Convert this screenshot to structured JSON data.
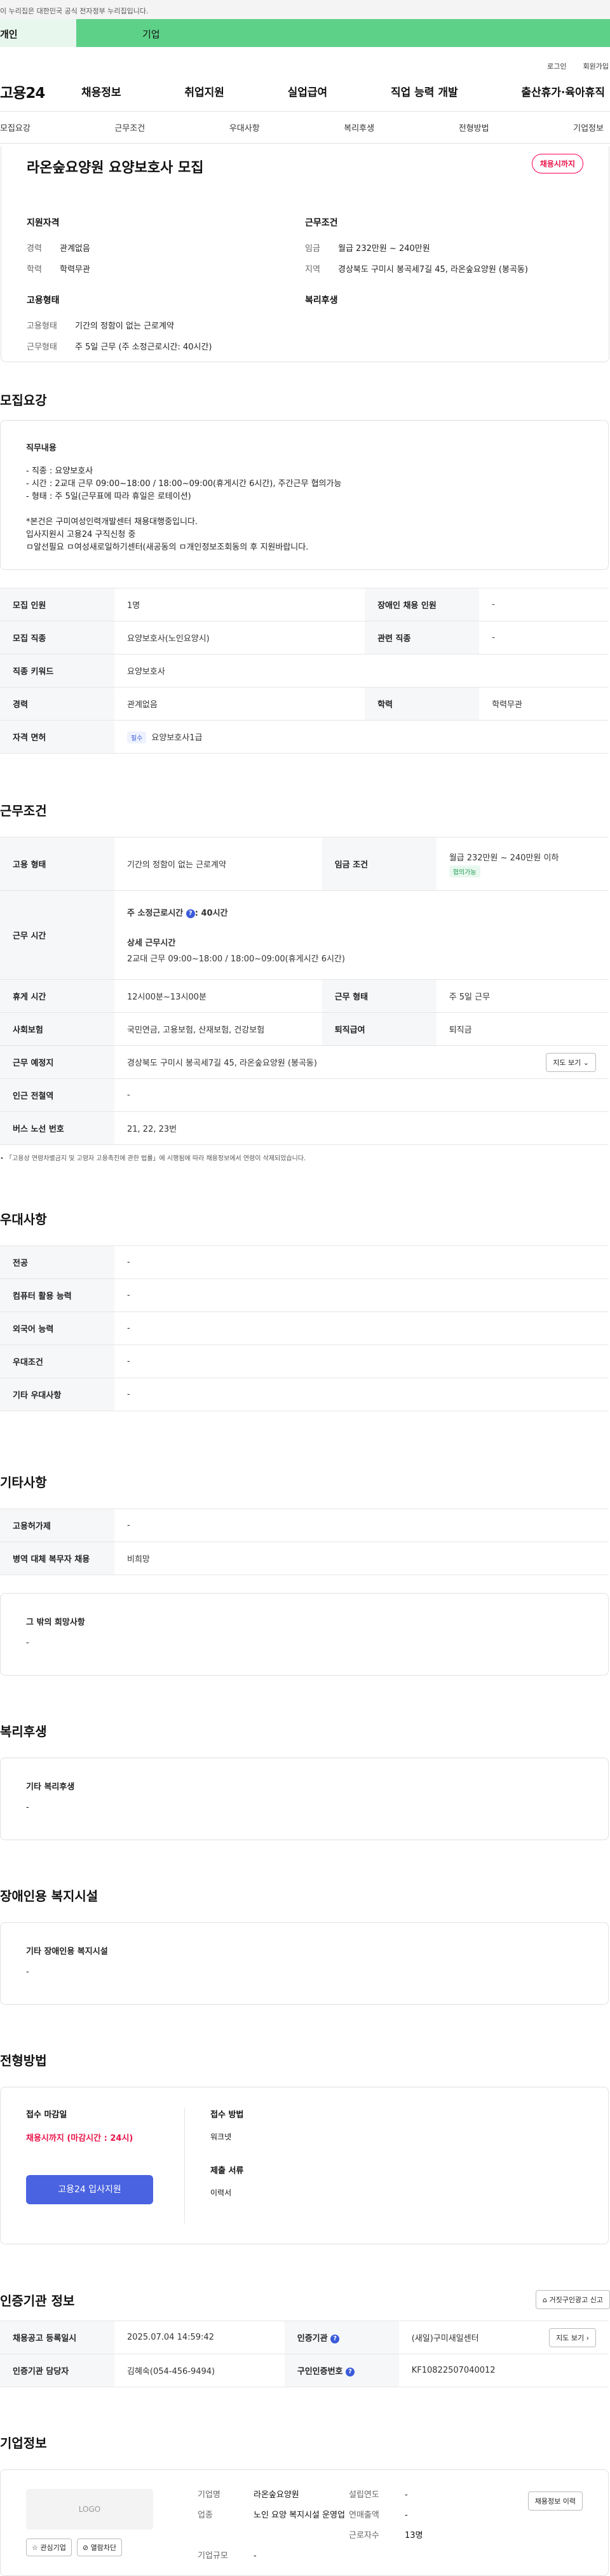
{
  "gov_notice": "이 누리집은 대한민국 공식 전자정부 누리집입니다.",
  "user_tabs": [
    "개인",
    "기업"
  ],
  "top_links": [
    "로그인",
    "회원가입"
  ],
  "logo": "고용24",
  "gnb": [
    "채용정보",
    "취업지원",
    "실업급여",
    "직업 능력 개발",
    "출산휴가·육아휴직"
  ],
  "subtabs": [
    "모집요강",
    "근무조건",
    "우대사항",
    "복리후생",
    "전형방법",
    "기업정보"
  ],
  "summary": {
    "title": "라온숲요양원 요양보호사 모집",
    "badge": "채용시까지",
    "support_title": "지원자격",
    "support": [
      {
        "k": "경력",
        "v": "관계없음"
      },
      {
        "k": "학력",
        "v": "학력무관"
      }
    ],
    "work_title": "근무조건",
    "work": [
      {
        "k": "임금",
        "v": "월급 232만원 ~ 240만원"
      },
      {
        "k": "지역",
        "v": "경상북도 구미시 봉곡세7길 45, 라온숲요양원 (봉곡동)"
      }
    ],
    "emp_title": "고용형태",
    "emp": [
      {
        "k": "고용형태",
        "v": "기간의 정함이 없는 근로계약"
      },
      {
        "k": "근무형태",
        "v": "주 5일 근무 (주 소정근로시간: 40시간)"
      }
    ],
    "welfare_title": "복리후생"
  },
  "recruit": {
    "title": "모집요강",
    "desc_title": "직무내용",
    "desc_lines": [
      "- 직종 : 요양보호사",
      "- 시간 : 2교대 근무 09:00~18:00 / 18:00~09:00(휴게시간 6시간), 주간근무 협의가능",
      "- 형태 : 주 5일(근무표에 따라 휴일은 로테이션)",
      "",
      "*본건은 구미여성인력개발센터 채용대행중입니다.",
      "입사지원시 고용24 구직신청 중",
      "ㅁ알선필요 ㅁ여성새로일하기센터(새공동의 ㅁ개인정보조회동의 후 지원바랍니다."
    ],
    "rows": [
      [
        "모집 인원",
        "1명",
        "장애인 채용 인원",
        "-"
      ],
      [
        "모집 직종",
        "요양보호사(노인요양시)",
        "관련 직종",
        "-"
      ],
      [
        "직종 키워드",
        "요양보호사",
        "",
        ""
      ],
      [
        "경력",
        "관계없음",
        "학력",
        "학력무관"
      ]
    ],
    "license_label": "자격 면허",
    "license_pill": "필수",
    "license_value": "요양보호사1급"
  },
  "work": {
    "title": "근무조건",
    "emp_type_label": "고용 형태",
    "emp_type": "기간의 정함이 없는 근로계약",
    "wage_label": "임금 조건",
    "wage": "월급 232만원 ~ 240만원 이하",
    "wage_pill": "협의가능",
    "hours_label": "근무 시간",
    "hours_sub1": "주 소정근로시간",
    "hours_sub1_val": ": 40시간",
    "hours_sub2": "상세 근무시간",
    "hours_detail": "2교대 근무 09:00~18:00 / 18:00~09:00(휴게시간 6시간)",
    "rows": [
      [
        "휴게 시간",
        "12시00분~13시00분",
        "근무 형태",
        "주 5일 근무"
      ],
      [
        "사회보험",
        "국민연금, 고용보험, 산재보험, 건강보험",
        "퇴직급여",
        "퇴직금"
      ]
    ],
    "place_label": "근무 예정지",
    "place": "경상북도 구미시 봉곡세7길 45, 라온숲요양원 (봉곡동)",
    "map_btn": "지도 보기",
    "station_label": "인근 전철역",
    "station": "-",
    "bus_label": "버스 노선 번호",
    "bus": "21, 22, 23번",
    "notice": "• 「고용상 연령차별금지 및 고령자 고용촉진에 관한 법률」에 시행됨에 따라 채용정보에서 연령이 삭제되었습니다."
  },
  "pref": {
    "title": "우대사항",
    "rows": [
      [
        "전공",
        "-"
      ],
      [
        "컴퓨터 활용 능력",
        "-"
      ],
      [
        "외국어 능력",
        "-"
      ],
      [
        "우대조건",
        "-"
      ],
      [
        "기타 우대사항",
        "-"
      ]
    ]
  },
  "etc": {
    "title": "기타사항",
    "rows": [
      [
        "고용허가제",
        "-"
      ],
      [
        "병역 대체 복무자 채용",
        "비희망"
      ]
    ],
    "box_title": "그 밖의 희망사항",
    "box_value": "-"
  },
  "welfare": {
    "title": "복리후생",
    "box_title": "기타 복리후생",
    "box_value": "-"
  },
  "disabled": {
    "title": "장애인용 복지시설",
    "box_title": "기타 장애인용 복지시설",
    "box_value": "-"
  },
  "process": {
    "title": "전형방법",
    "deadline_label": "접수 마감일",
    "deadline": "채용시까지 (마감시간 : 24시)",
    "apply_btn": "고용24 입사지원",
    "method_label": "접수 방법",
    "method": "워크넷",
    "docs_label": "제출 서류",
    "docs": "이력서"
  },
  "agency": {
    "title": "인증기관 정보",
    "report_btn": "거짓구인광고 신고",
    "rows": [
      [
        "채용공고 등록일시",
        "2025.07.04 14:59:42",
        "인증기관",
        "(새일)구미새일센터"
      ],
      [
        "인증기관 담당자",
        "김혜숙(054-456-9494)",
        "구인인증번호",
        "KF10822507040012"
      ]
    ],
    "map_btn": "지도 보기"
  },
  "company": {
    "title": "기업정보",
    "logo": "LOGO",
    "fav_btn": "관심기업",
    "block_btn": "열람차단",
    "info_btn": "채용정보 이력",
    "name_label": "기업명",
    "name": "라온숲요양원",
    "founded_label": "설립연도",
    "founded": "-",
    "industry_label": "업종",
    "industry": "노인 요양 복지시설 운영업",
    "sales_label": "연매출액",
    "sales": "-",
    "staff_label": "근로자수",
    "staff": "13명",
    "size_label": "기업규모",
    "size": "-"
  }
}
